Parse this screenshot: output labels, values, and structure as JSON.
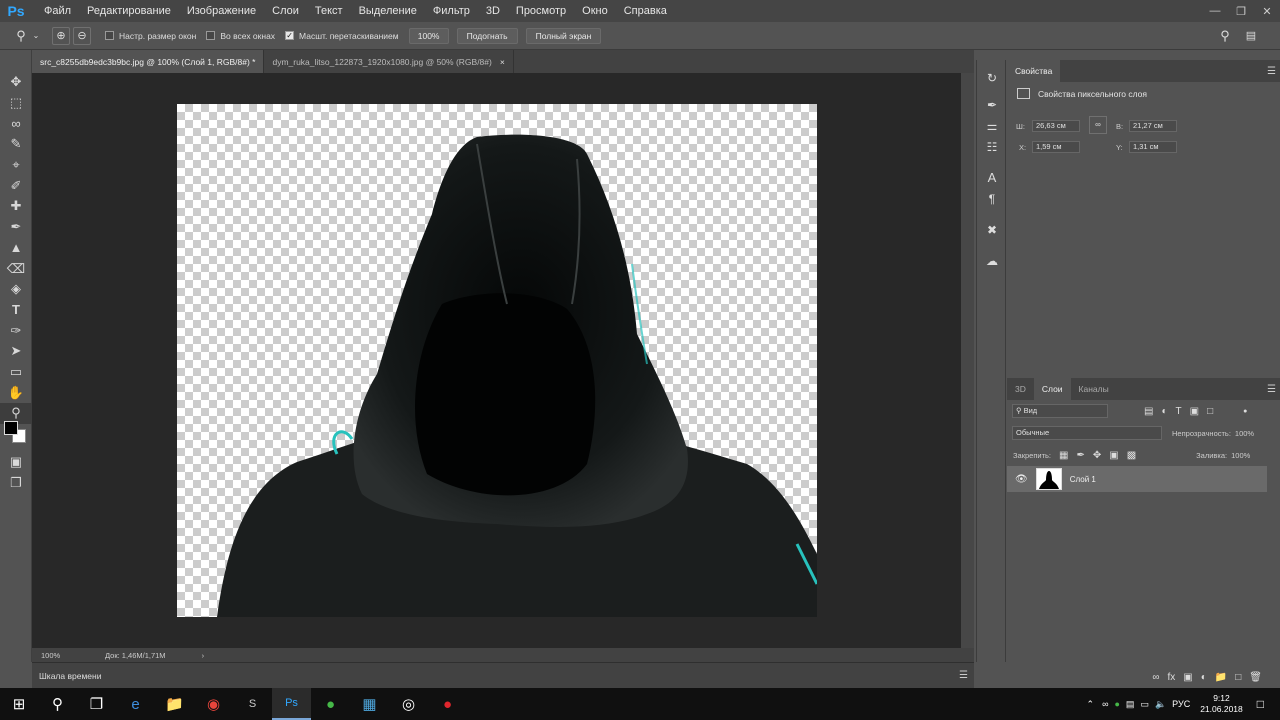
{
  "app": {
    "logo": "Ps"
  },
  "menu": [
    "Файл",
    "Редактирование",
    "Изображение",
    "Слои",
    "Текст",
    "Выделение",
    "Фильтр",
    "3D",
    "Просмотр",
    "Окно",
    "Справка"
  ],
  "options": {
    "resize_windows": "Настр. размер окон",
    "all_windows": "Во всех окнах",
    "scrubby_zoom": "Масшт. перетаскиванием",
    "zoom_value": "100%",
    "fit_label": "Подогнать",
    "fullscreen_label": "Полный экран"
  },
  "tabs": [
    {
      "title": "src_c8255db9edc3b9bc.jpg @ 100% (Слой 1, RGB/8#) *",
      "active": true
    },
    {
      "title": "dym_ruka_litso_122873_1920x1080.jpg @ 50% (RGB/8#)",
      "active": false
    }
  ],
  "status": {
    "zoom": "100%",
    "doc": "Док: 1,46M/1,71M"
  },
  "timeline": {
    "label": "Шкала времени"
  },
  "properties": {
    "tab": "Свойства",
    "title": "Свойства пиксельного слоя",
    "w_label": "Ш:",
    "w_value": "26,63 см",
    "h_label": "В:",
    "h_value": "21,27 см",
    "x_label": "X:",
    "x_value": "1,59 см",
    "y_label": "Y:",
    "y_value": "1,31 см"
  },
  "layers_panel": {
    "tabs": [
      "3D",
      "Слои",
      "Каналы"
    ],
    "active_tab": "Слои",
    "filter": "Вид",
    "blend_mode": "Обычные",
    "opacity_label": "Непрозрачность:",
    "opacity_value": "100%",
    "lock_label": "Закрепить:",
    "fill_label": "Заливка:",
    "fill_value": "100%",
    "layers": [
      {
        "name": "Слой 1",
        "visible": true
      }
    ]
  },
  "taskbar": {
    "lang": "РУС",
    "time": "9:12",
    "date": "21.06.2018"
  },
  "colors": {
    "accent": "#31a8ff",
    "panel": "#535353",
    "dark": "#424242",
    "canvas_bg": "#282828"
  }
}
